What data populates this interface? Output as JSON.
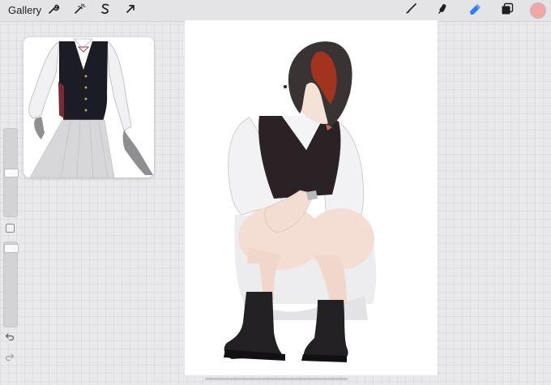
{
  "app": {
    "gallery_label": "Gallery"
  },
  "toolbar": {
    "left_tools": [
      {
        "name": "actions",
        "icon": "wrench-icon"
      },
      {
        "name": "adjustments",
        "icon": "magic-wand-icon"
      },
      {
        "name": "selection",
        "icon": "selection-s-icon"
      },
      {
        "name": "transform",
        "icon": "arrow-cursor-icon"
      }
    ],
    "right_tools": [
      {
        "name": "brush",
        "icon": "brush-icon",
        "active": false
      },
      {
        "name": "smudge",
        "icon": "smudge-icon",
        "active": false
      },
      {
        "name": "eraser",
        "icon": "eraser-icon",
        "active": true
      },
      {
        "name": "layers",
        "icon": "layers-icon",
        "active": false
      }
    ],
    "current_color": "#f3a6a6",
    "accent_color": "#2f7cf6"
  },
  "sidebar": {
    "brush_size_level": 0.49,
    "opacity_level": 0.98,
    "modify_button_icon": "square-icon",
    "undo_icon": "undo-arrow-icon",
    "redo_icon": "redo-arrow-icon"
  },
  "reference_window": {
    "content": "reference-image"
  },
  "canvas": {
    "content": "artwork"
  }
}
